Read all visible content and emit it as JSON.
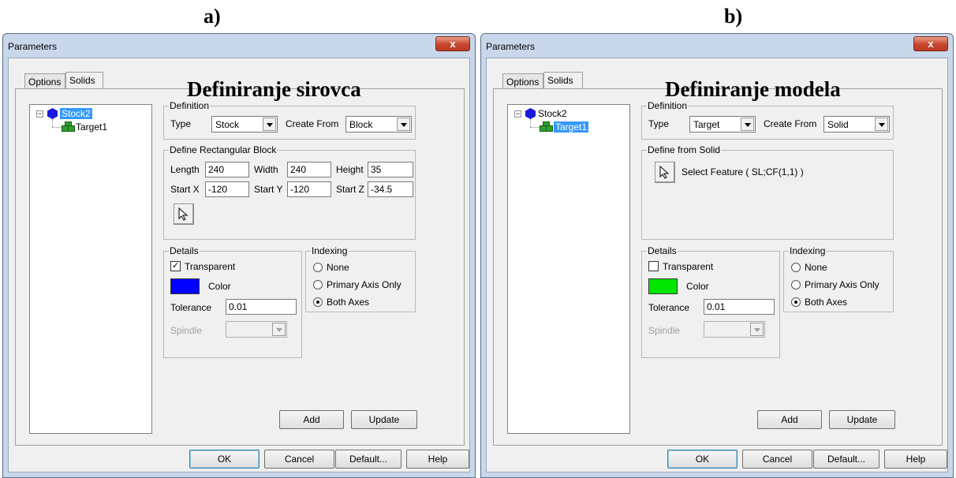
{
  "labels": {
    "a": "a)",
    "b": "b)"
  },
  "colors": {
    "stock_blue": "#1a1adc",
    "target_green": "#2e9e2e",
    "selection": "#3399ff",
    "color_a": "#0000ff",
    "color_b": "#00e600"
  },
  "windows": [
    {
      "title": "Parameters",
      "close_label": "x",
      "tabs": [
        "Options",
        "Solids"
      ],
      "active_tab": "Solids",
      "heading": "Definiranje sirovca",
      "tree": {
        "root": "Stock2",
        "child": "Target1",
        "selected": "Stock2"
      },
      "definition": {
        "group": "Definition",
        "type_label": "Type",
        "type_value": "Stock",
        "create_label": "Create From",
        "create_value": "Block"
      },
      "block": {
        "group": "Define Rectangular Block",
        "length_label": "Length",
        "length": "240",
        "width_label": "Width",
        "width": "240",
        "height_label": "Height",
        "height": "35",
        "startx_label": "Start X",
        "startx": "-120",
        "starty_label": "Start Y",
        "starty": "-120",
        "startz_label": "Start Z",
        "startz": "-34.5"
      },
      "details": {
        "group": "Details",
        "transparent_label": "Transparent",
        "transparent": true,
        "color_label": "Color",
        "tolerance_label": "Tolerance",
        "tolerance": "0.01",
        "spindle_label": "Spindle"
      },
      "indexing": {
        "group": "Indexing",
        "options": [
          "None",
          "Primary Axis Only",
          "Both Axes"
        ],
        "selected": "Both Axes"
      },
      "buttons": {
        "add": "Add",
        "update": "Update",
        "ok": "OK",
        "cancel": "Cancel",
        "default": "Default...",
        "help": "Help"
      }
    },
    {
      "title": "Parameters",
      "close_label": "x",
      "tabs": [
        "Options",
        "Solids"
      ],
      "active_tab": "Solids",
      "heading": "Definiranje modela",
      "tree": {
        "root": "Stock2",
        "child": "Target1",
        "selected": "Target1"
      },
      "definition": {
        "group": "Definition",
        "type_label": "Type",
        "type_value": "Target",
        "create_label": "Create From",
        "create_value": "Solid"
      },
      "solid": {
        "group": "Define from Solid",
        "select_text": "Select Feature ( SL;CF(1,1) )"
      },
      "details": {
        "group": "Details",
        "transparent_label": "Transparent",
        "transparent": false,
        "color_label": "Color",
        "tolerance_label": "Tolerance",
        "tolerance": "0.01",
        "spindle_label": "Spindle"
      },
      "indexing": {
        "group": "Indexing",
        "options": [
          "None",
          "Primary Axis Only",
          "Both Axes"
        ],
        "selected": "Both Axes"
      },
      "buttons": {
        "add": "Add",
        "update": "Update",
        "ok": "OK",
        "cancel": "Cancel",
        "default": "Default...",
        "help": "Help"
      }
    }
  ]
}
